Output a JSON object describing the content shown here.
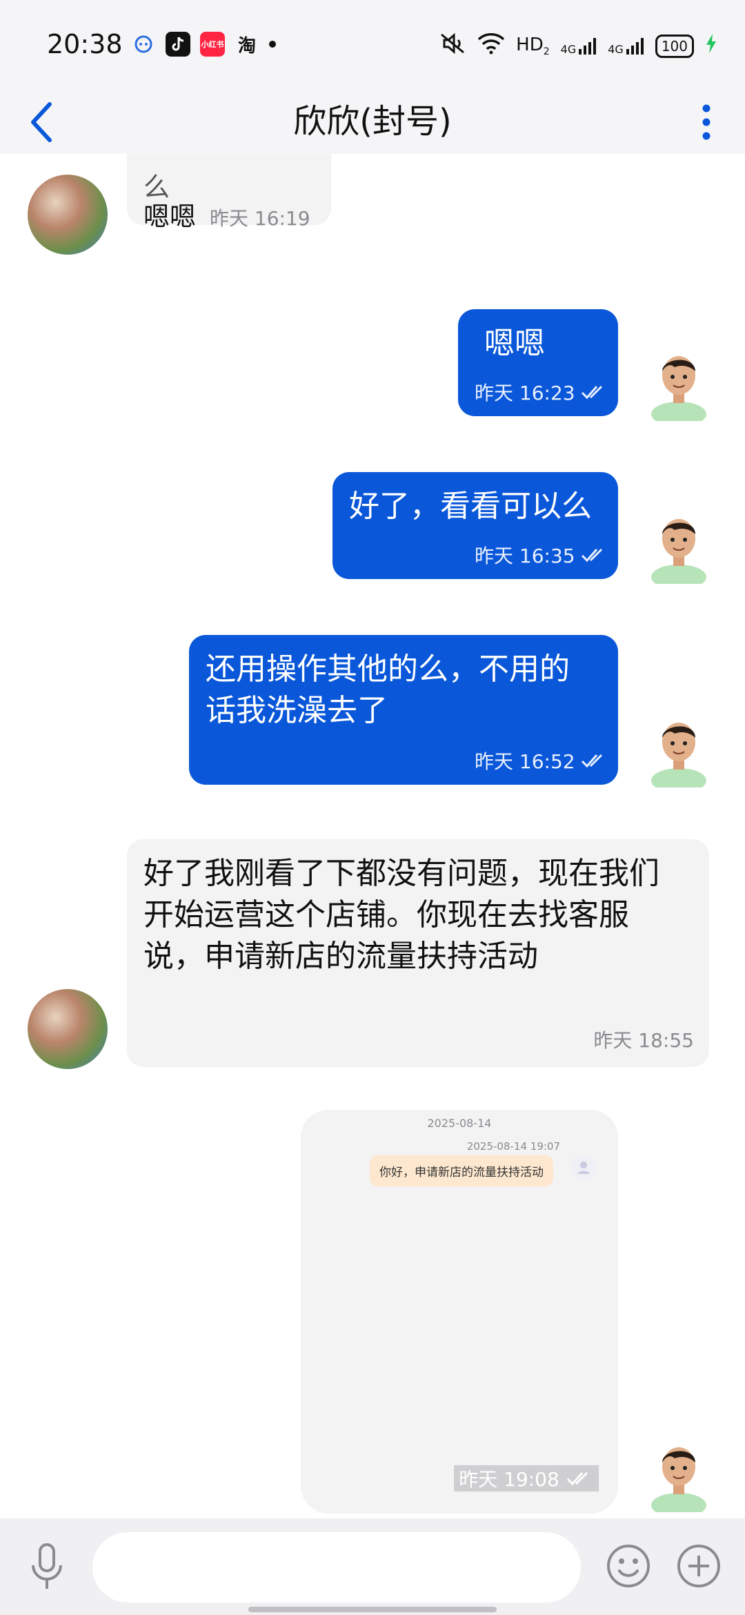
{
  "status_bar": {
    "time": "20:38",
    "app_icons": [
      "chat-bubble-icon",
      "douyin-icon",
      "xiaohongshu-icon",
      "taobao-icon",
      "dot-icon"
    ],
    "xiaohongshu_label": "小红书",
    "taobao_label": "淘",
    "hd_label": "HD",
    "hd_sub": "2",
    "net1": "4G",
    "net2": "4G",
    "battery": "100"
  },
  "header": {
    "title": "欣欣(封号)"
  },
  "messages": [
    {
      "id": "m0",
      "direction": "in",
      "partial_text": "么",
      "text": "嗯嗯",
      "time": "昨天 16:19"
    },
    {
      "id": "m1",
      "direction": "out",
      "text": "嗯嗯",
      "time": "昨天 16:23"
    },
    {
      "id": "m2",
      "direction": "out",
      "text": "好了，看看可以么",
      "time": "昨天 16:35"
    },
    {
      "id": "m3",
      "direction": "out",
      "text_line1": "还用操作其他的么，不用的",
      "text_line2": "话我洗澡去了",
      "time": "昨天 16:52"
    },
    {
      "id": "m4",
      "direction": "in",
      "text_line1": "好了我刚看了下都没有问题，现在我们",
      "text_line2": "开始运营这个店铺。你现在去找客服",
      "text_line3": "说，申请新店的流量扶持活动",
      "time": "昨天 18:55"
    },
    {
      "id": "m5",
      "direction": "out",
      "type": "image",
      "image_date": "2025-08-14",
      "image_time": "2025-08-14 19:07",
      "image_message": "你好，申请新店的流量扶持活动",
      "time": "昨天 19:08"
    }
  ],
  "input": {
    "placeholder": ""
  },
  "colors": {
    "accent": "#0a58d9",
    "incoming_bubble": "#f3f3f4",
    "header_bg": "#f5f5f7"
  }
}
